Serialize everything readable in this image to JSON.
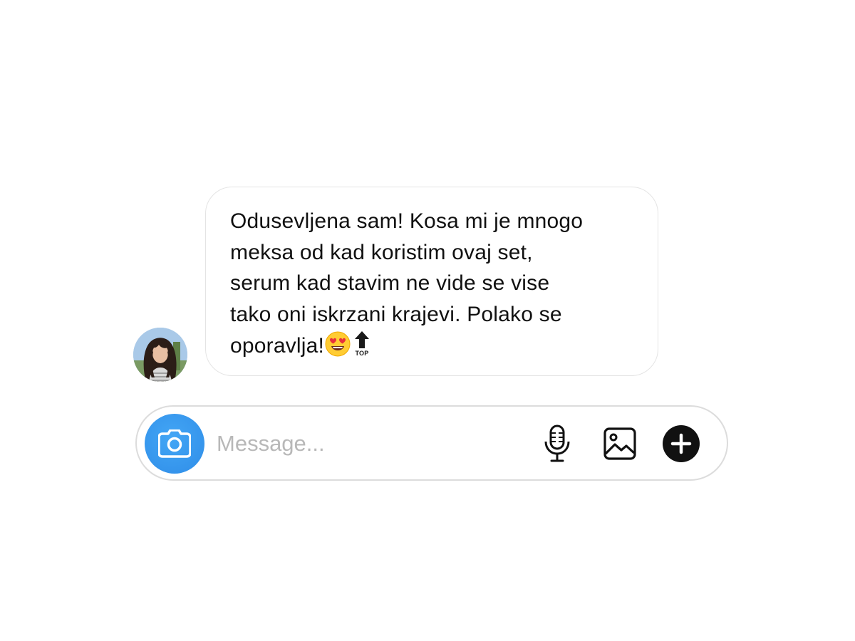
{
  "conversation": {
    "incoming_message": {
      "text_lines": [
        "Odusevljena sam! Kosa mi je mnogo",
        "meksa od kad koristim ovaj set,",
        "serum kad stavim ne vide se vise",
        "tako oni iskrzani krajevi. Polako se",
        "oporavlja!"
      ],
      "emojis": [
        "heart-eyes-emoji",
        "top-arrow-emoji"
      ],
      "top_emoji_caption": "TOP"
    },
    "sender_avatar": "avatar-photo"
  },
  "composer": {
    "placeholder": "Message...",
    "value": "",
    "icons": {
      "camera": "camera-icon",
      "mic": "microphone-icon",
      "gallery": "image-icon",
      "more": "plus-icon"
    }
  },
  "colors": {
    "camera_button": "#3797f0",
    "plus_button": "#111111",
    "bubble_border": "#e4e4e4",
    "composer_border": "#dcdcdc",
    "placeholder": "#b8b8b8"
  }
}
